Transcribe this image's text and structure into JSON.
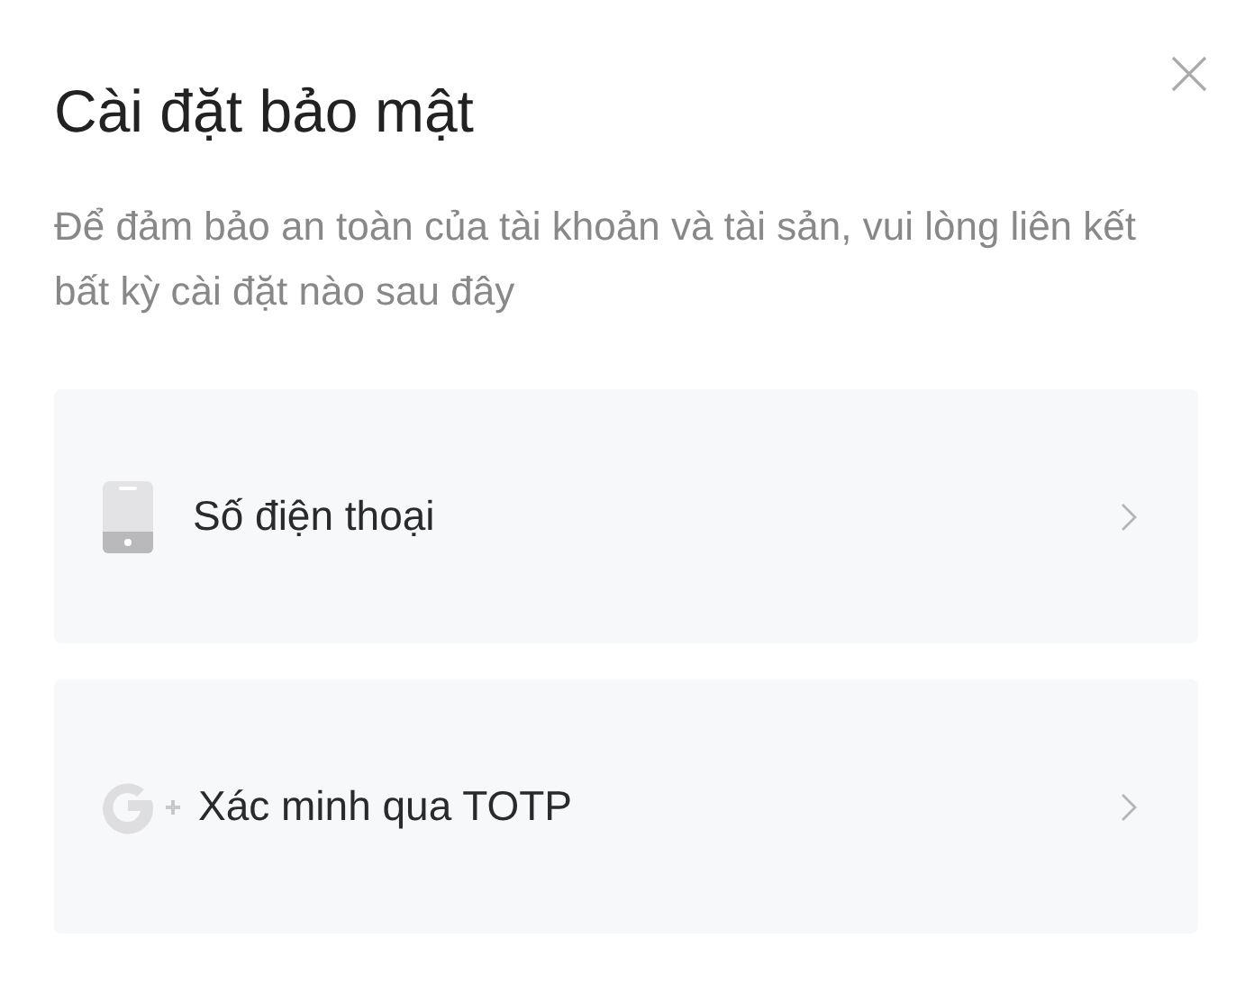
{
  "dialog": {
    "title": "Cài đặt bảo mật",
    "description": "Để đảm bảo an toàn của tài khoản và tài sản, vui lòng liên kết bất kỳ cài đặt nào sau đây"
  },
  "options": [
    {
      "kind": "phone",
      "label": "Số điện thoại"
    },
    {
      "kind": "totp",
      "label": "Xác minh qua TOTP"
    }
  ]
}
